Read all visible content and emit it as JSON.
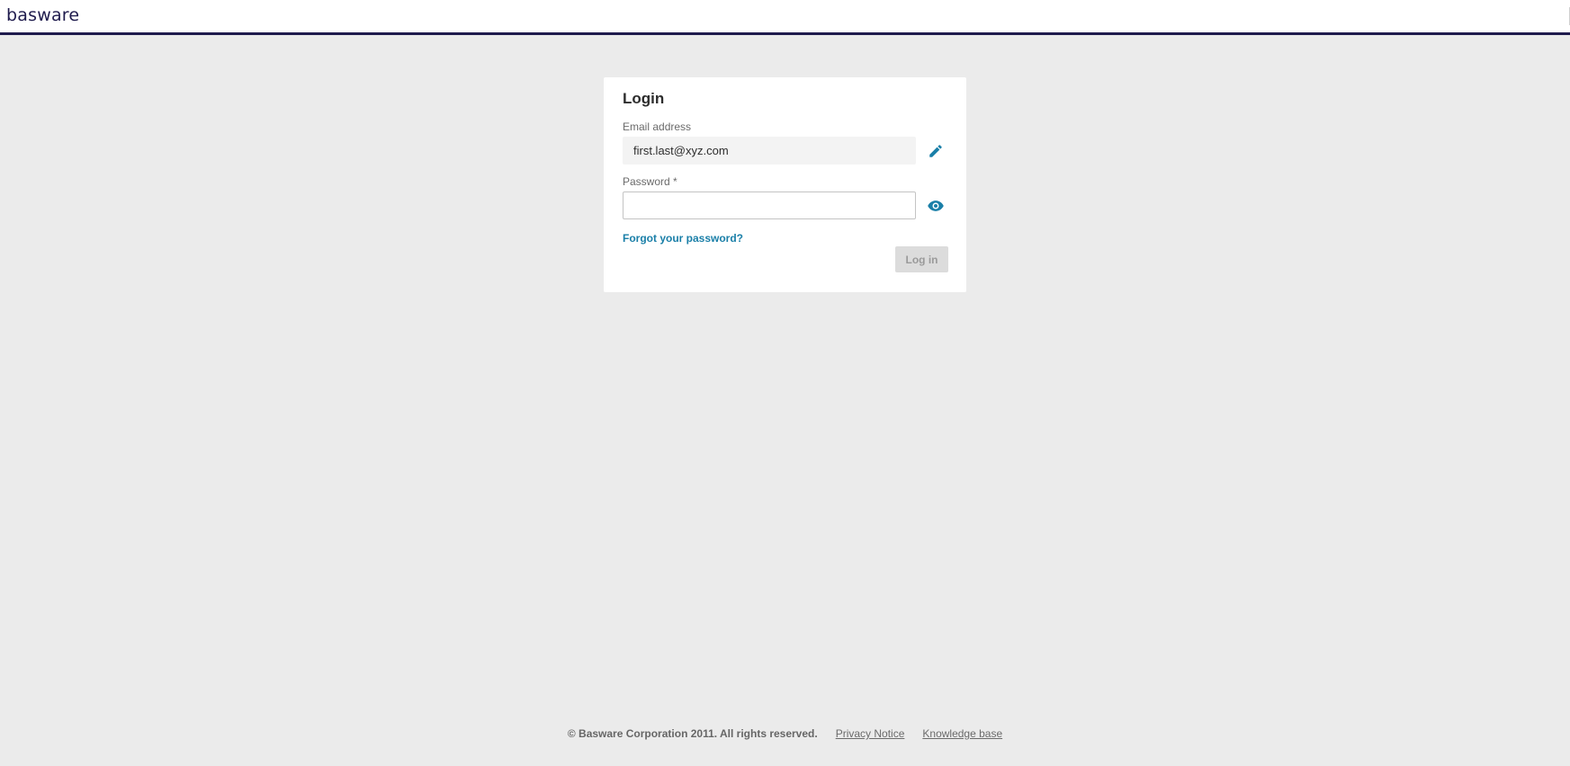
{
  "header": {
    "logo_text": "basware"
  },
  "login": {
    "title": "Login",
    "email_label": "Email address",
    "email_value": "first.last@xyz.com",
    "password_label": "Password *",
    "password_value": "",
    "forgot_link": "Forgot your password?",
    "login_button": "Log in",
    "icons": {
      "edit": "pencil-icon",
      "show_password": "eye-icon"
    }
  },
  "footer": {
    "copyright": "© Basware Corporation 2011. All rights reserved.",
    "privacy_link": "Privacy Notice",
    "knowledge_link": "Knowledge base"
  },
  "colors": {
    "brand": "#1f1b4d",
    "accent": "#1a7fa8",
    "background": "#ebebeb",
    "button_disabled": "#dcdcdc"
  }
}
